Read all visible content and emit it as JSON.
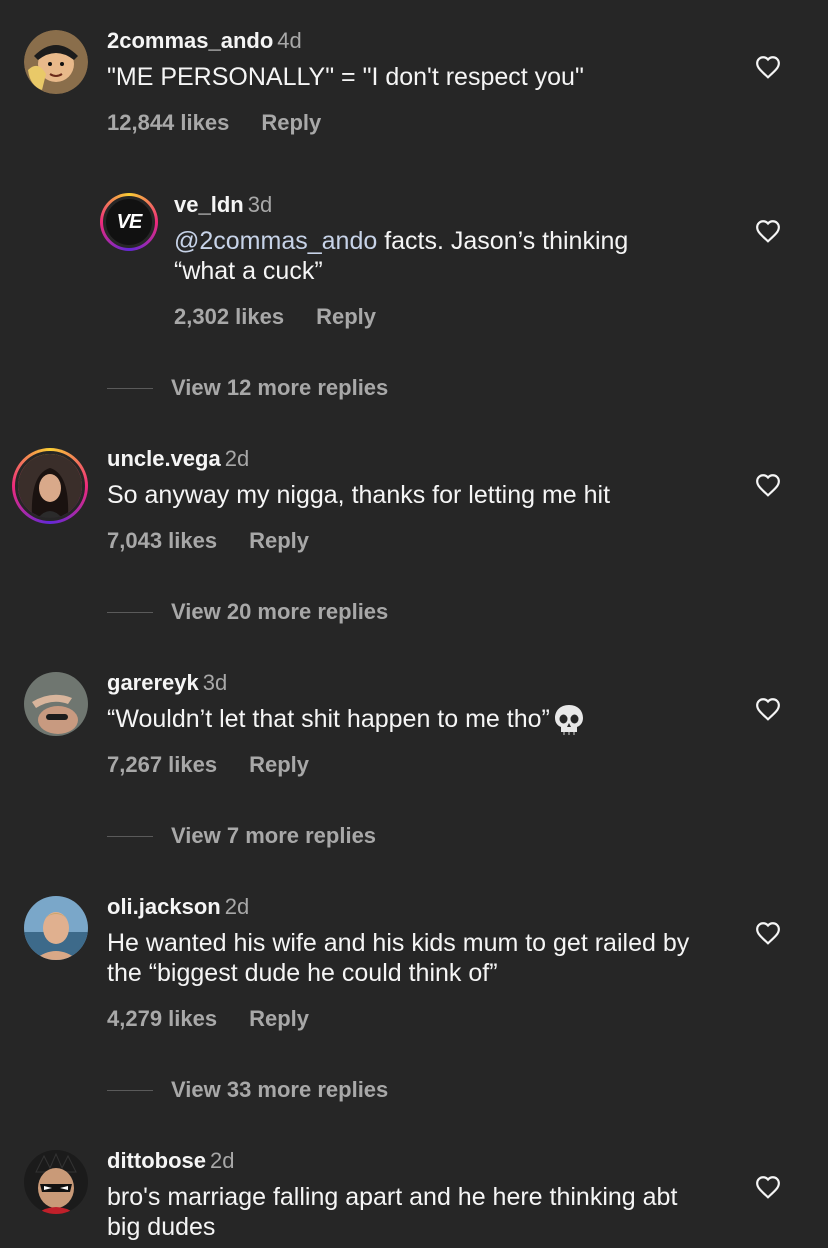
{
  "comments": [
    {
      "username": "2commas_ando",
      "time": "4d",
      "text": "\"ME PERSONALLY\" = \"I don't respect you\"",
      "likes": "12,844 likes",
      "reply": "Reply"
    },
    {
      "username": "ve_ldn",
      "time": "3d",
      "mention": "@2commas_ando",
      "text": " facts. Jason’s thinking “what a cuck”",
      "likes": "2,302 likes",
      "reply": "Reply",
      "avatar_text": "VE"
    },
    {
      "username": "uncle.vega",
      "time": "2d",
      "text": "So anyway my nigga, thanks for letting me hit",
      "likes": "7,043 likes",
      "reply": "Reply"
    },
    {
      "username": "garereyk",
      "time": "3d",
      "text": "“Wouldn’t let that shit happen to me tho”",
      "likes": "7,267 likes",
      "reply": "Reply"
    },
    {
      "username": "oli.jackson",
      "time": "2d",
      "text": "He wanted his wife and his kids mum to get railed by the “biggest dude he could think of”",
      "likes": "4,279 likes",
      "reply": "Reply"
    },
    {
      "username": "dittobose",
      "time": "2d",
      "text": "bro's marriage falling apart and he here thinking abt big dudes"
    }
  ],
  "view_more": [
    "View 12 more replies",
    "View 20 more replies",
    "View 7 more replies",
    "View 33 more replies"
  ],
  "colors": {
    "background": "#262626",
    "text": "#f5f5f5",
    "muted": "#a8a8a8",
    "mention": "#c7d3e8"
  },
  "icons": {
    "like": "heart-outline-icon",
    "emoji": "skull-emoji-icon"
  }
}
